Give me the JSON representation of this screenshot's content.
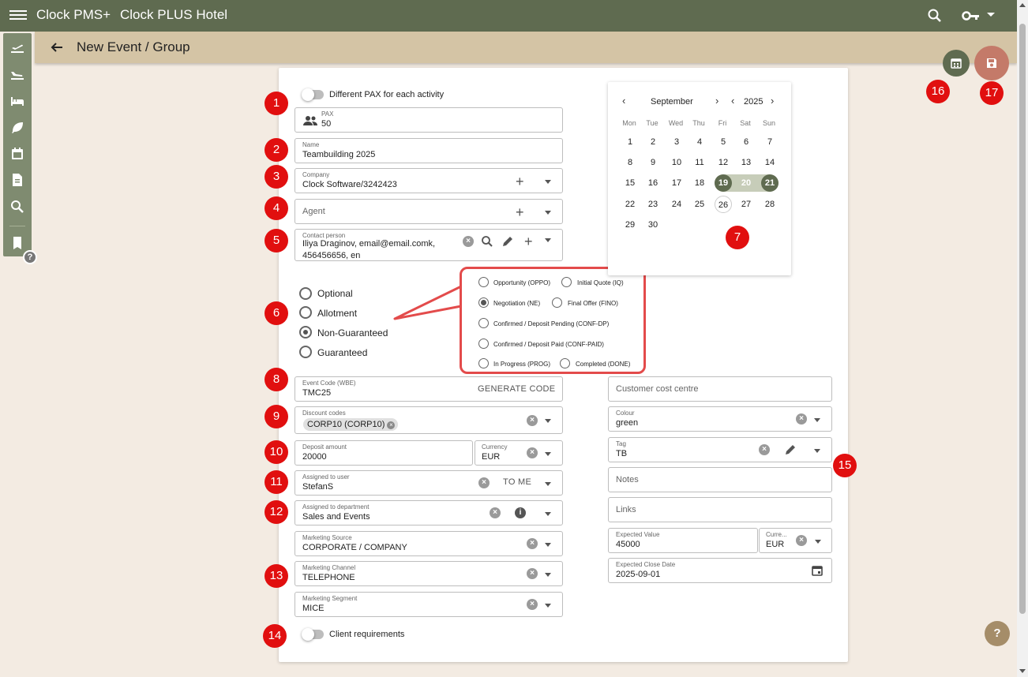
{
  "app": {
    "name": "Clock PMS+",
    "hotel": "Clock PLUS Hotel"
  },
  "page": {
    "title": "New Event / Group"
  },
  "toggles": {
    "different_pax": "Different PAX for each activity",
    "client_requirements": "Client requirements"
  },
  "fields": {
    "pax": {
      "label": "PAX",
      "value": "50"
    },
    "name": {
      "label": "Name",
      "value": "Teambuilding 2025"
    },
    "company": {
      "label": "Company",
      "value": "Clock Software/3242423"
    },
    "agent": {
      "placeholder": "Agent"
    },
    "contact_person": {
      "label": "Contact person",
      "value_line1": "Iliya Draginov, email@email.comk,",
      "value_line2": "456456656, en"
    },
    "event_code": {
      "label": "Event Code (WBE)",
      "value": "TMC25",
      "action": "GENERATE CODE"
    },
    "discount_codes": {
      "label": "Discount codes",
      "chip": "CORP10 (CORP10)"
    },
    "deposit_amount": {
      "label": "Deposit amount",
      "value": "20000"
    },
    "currency": {
      "label": "Currency",
      "value": "EUR"
    },
    "assigned_user": {
      "label": "Assigned to user",
      "value": "StefanS",
      "action": "TO ME"
    },
    "assigned_department": {
      "label": "Assigned to department",
      "value": "Sales and Events"
    },
    "marketing_source": {
      "label": "Marketing Source",
      "value": "CORPORATE / COMPANY"
    },
    "marketing_channel": {
      "label": "Marketing Channel",
      "value": "TELEPHONE"
    },
    "marketing_segment": {
      "label": "Marketing Segment",
      "value": "MICE"
    },
    "customer_cost_centre": {
      "placeholder": "Customer cost centre"
    },
    "colour": {
      "label": "Colour",
      "value": "green"
    },
    "tag": {
      "label": "Tag",
      "value": "TB"
    },
    "notes": {
      "placeholder": "Notes"
    },
    "links": {
      "placeholder": "Links"
    },
    "expected_value": {
      "label": "Expected Value",
      "value": "45000"
    },
    "expected_currency": {
      "label": "Curre...",
      "value": "EUR"
    },
    "expected_close_date": {
      "label": "Expected Close Date",
      "value": "2025-09-01"
    }
  },
  "booking_type": {
    "options": [
      "Optional",
      "Allotment",
      "Non-Guaranteed",
      "Guaranteed"
    ],
    "selected": "Non-Guaranteed"
  },
  "status_options": {
    "oppo": "Opportunity (OPPO)",
    "iq": "Initial Quote (IQ)",
    "ne": "Negotiation (NE)",
    "fino": "Final Offer (FINO)",
    "conf_dp": "Confirmed / Deposit Pending (CONF-DP)",
    "conf_paid": "Confirmed / Deposit Paid (CONF-PAID)",
    "prog": "In Progress (PROG)",
    "done": "Completed (DONE)",
    "selected": "Negotiation (NE)"
  },
  "calendar": {
    "month": "September",
    "year": "2025",
    "weekdays": [
      "Mon",
      "Tue",
      "Wed",
      "Thu",
      "Fri",
      "Sat",
      "Sun"
    ],
    "days": [
      "1",
      "2",
      "3",
      "4",
      "5",
      "6",
      "7",
      "8",
      "9",
      "10",
      "11",
      "12",
      "13",
      "14",
      "15",
      "16",
      "17",
      "18",
      "19",
      "20",
      "21",
      "22",
      "23",
      "24",
      "25",
      "26",
      "27",
      "28",
      "29",
      "30"
    ],
    "selected_range": [
      "19",
      "21"
    ],
    "today": "26"
  },
  "annotations": [
    "1",
    "2",
    "3",
    "4",
    "5",
    "6",
    "7",
    "8",
    "9",
    "10",
    "11",
    "12",
    "13",
    "14",
    "15",
    "16",
    "17"
  ],
  "icons": {
    "menu": "menu-icon",
    "search": "search-icon",
    "key": "key-icon",
    "back": "arrow-back-icon",
    "save": "save-icon",
    "calendar": "calendar-icon",
    "help": "help-icon"
  },
  "colors": {
    "topbar": "#5f6b50",
    "subbar": "#d4c4a5",
    "badge": "#e10f0f",
    "save": "#c47a69"
  },
  "help_glyph": "?"
}
